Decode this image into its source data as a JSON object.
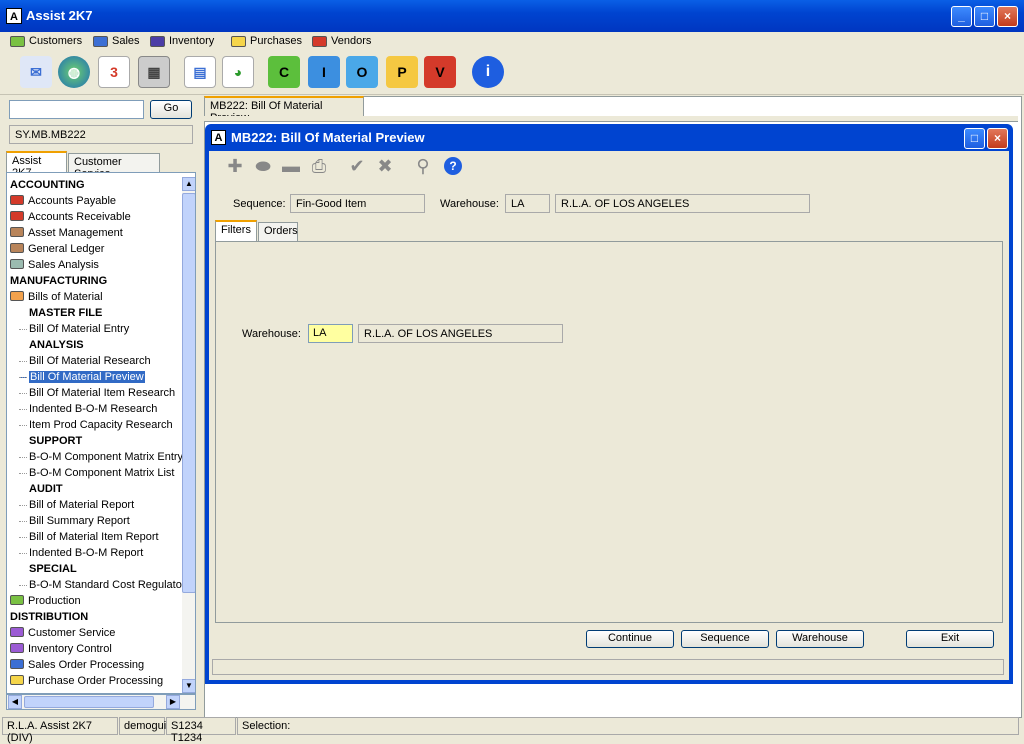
{
  "app": {
    "title": "Assist 2K7"
  },
  "menu": [
    "Customers",
    "Sales",
    "Inventory",
    "Purchases",
    "Vendors"
  ],
  "menu_colors": [
    "#7ac143",
    "#3c6fd4",
    "#4b3da6",
    "#f5d54a",
    "#d43a2a"
  ],
  "toolbar": {
    "letters": [
      "C",
      "I",
      "O",
      "P",
      "V"
    ]
  },
  "search": {
    "value": "",
    "go_label": "Go",
    "path": "SY.MB.MB222"
  },
  "left_tabs": [
    "Assist 2K7",
    "Customer Service"
  ],
  "tree": [
    {
      "t": "ACCOUNTING",
      "k": "head"
    },
    {
      "t": "Accounts Payable",
      "k": "folder",
      "c": "#d43a2a"
    },
    {
      "t": "Accounts Receivable",
      "k": "folder",
      "c": "#d43a2a"
    },
    {
      "t": "Asset Management",
      "k": "folder",
      "c": "#b8845a"
    },
    {
      "t": "General Ledger",
      "k": "folder",
      "c": "#b8845a"
    },
    {
      "t": "Sales Analysis",
      "k": "folder",
      "c": "#9bbbb0"
    },
    {
      "t": "MANUFACTURING",
      "k": "head"
    },
    {
      "t": "Bills of Material",
      "k": "folder",
      "c": "#f3a24d"
    },
    {
      "t": "MASTER FILE",
      "k": "sub"
    },
    {
      "t": "Bill Of Material Entry",
      "k": "leaf"
    },
    {
      "t": "ANALYSIS",
      "k": "sub"
    },
    {
      "t": "Bill Of Material Research",
      "k": "leaf"
    },
    {
      "t": "Bill Of Material Preview",
      "k": "sel"
    },
    {
      "t": "Bill Of Material Item Research",
      "k": "leaf"
    },
    {
      "t": "Indented B-O-M Research",
      "k": "leaf"
    },
    {
      "t": "Item Prod Capacity Research",
      "k": "leaf"
    },
    {
      "t": "SUPPORT",
      "k": "sub"
    },
    {
      "t": "B-O-M Component Matrix Entry",
      "k": "leaf"
    },
    {
      "t": "B-O-M Component Matrix List",
      "k": "leaf"
    },
    {
      "t": "AUDIT",
      "k": "sub"
    },
    {
      "t": "Bill of Material Report",
      "k": "leaf"
    },
    {
      "t": "Bill Summary Report",
      "k": "leaf"
    },
    {
      "t": "Bill of Material Item Report",
      "k": "leaf"
    },
    {
      "t": "Indented B-O-M Report",
      "k": "leaf"
    },
    {
      "t": "SPECIAL",
      "k": "sub"
    },
    {
      "t": "B-O-M Standard Cost Regulato",
      "k": "leaf"
    },
    {
      "t": "Production",
      "k": "folder",
      "c": "#7ac143"
    },
    {
      "t": "DISTRIBUTION",
      "k": "head"
    },
    {
      "t": "Customer Service",
      "k": "folder",
      "c": "#9b5bd4"
    },
    {
      "t": "Inventory Control",
      "k": "folder",
      "c": "#9b5bd4"
    },
    {
      "t": "Sales Order Processing",
      "k": "folder",
      "c": "#3c6fd4"
    },
    {
      "t": "Purchase Order Processing",
      "k": "folder",
      "c": "#f5d54a"
    }
  ],
  "doc_tab": "MB222: Bill Of Material Preview",
  "window": {
    "title": "MB222: Bill Of Material Preview"
  },
  "form": {
    "sequence_label": "Sequence:",
    "sequence_value": "Fin-Good Item",
    "warehouse_label": "Warehouse:",
    "warehouse_code": "LA",
    "warehouse_name": "R.L.A. OF LOS ANGELES",
    "tabs": [
      "Filters",
      "Orders"
    ],
    "filter_wh_label": "Warehouse:",
    "filter_wh_code": "LA",
    "filter_wh_name": "R.L.A. OF LOS ANGELES"
  },
  "buttons": {
    "continue": "Continue",
    "sequence": "Sequence",
    "warehouse": "Warehouse",
    "exit": "Exit"
  },
  "status": {
    "company": "R.L.A. Assist 2K7 (DIV)",
    "user": "demogui",
    "session": "S1234 T1234",
    "selection": "Selection:"
  }
}
